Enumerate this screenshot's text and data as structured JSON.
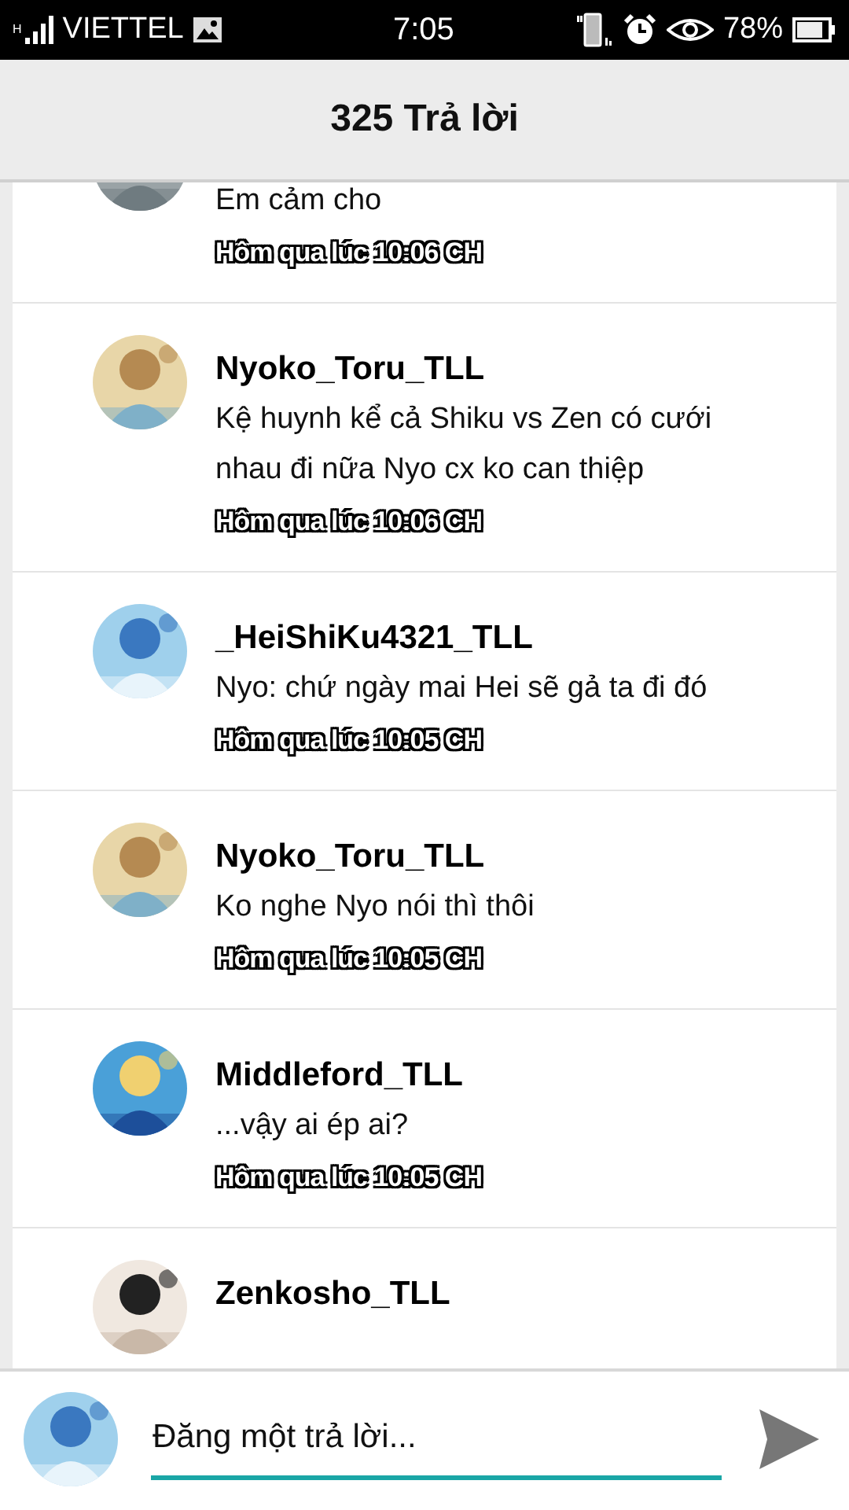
{
  "status_bar": {
    "carrier": "VIETTEL",
    "network": "H",
    "time": "7:05",
    "battery": "78%"
  },
  "header": {
    "title": "325 Trả lời"
  },
  "replies": [
    {
      "message": "Em cảm cho",
      "time": "Hôm qua lúc 10:06 CH"
    },
    {
      "username": "Nyoko_Toru_TLL",
      "message": "Kệ huynh kể cả Shiku vs Zen có cưới nhau đi nữa Nyo cx ko can thiệp",
      "time": "Hôm qua lúc 10:06 CH"
    },
    {
      "username": "_HeiShiKu4321_TLL",
      "message": "Nyo: chứ ngày mai Hei sẽ gả ta đi đó",
      "time": "Hôm qua lúc 10:05 CH"
    },
    {
      "username": "Nyoko_Toru_TLL",
      "message": "Ko nghe Nyo nói thì thôi",
      "time": "Hôm qua lúc 10:05 CH"
    },
    {
      "username": "Middleford_TLL",
      "message": "...vậy ai ép ai?",
      "time": "Hôm qua lúc 10:05 CH"
    },
    {
      "username": "Zenkosho_TLL"
    }
  ],
  "composer": {
    "placeholder": "Đăng một trả lời..."
  }
}
